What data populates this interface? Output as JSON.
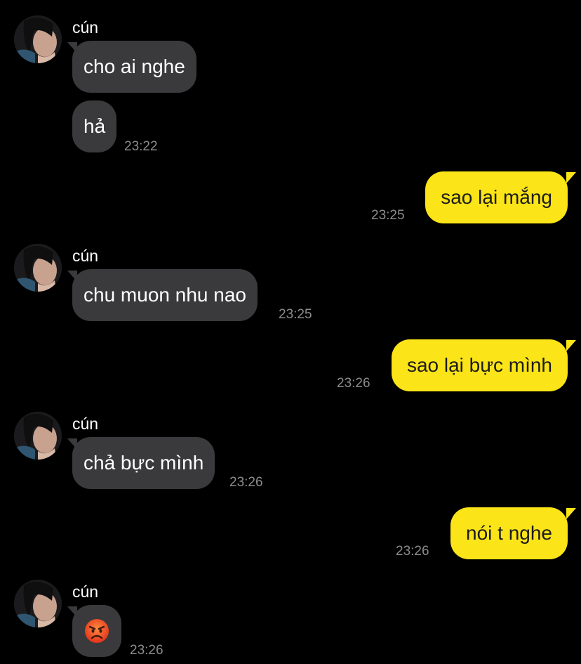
{
  "messages": [
    {
      "side": "in",
      "sender": "cún",
      "text": "cho ai nghe"
    },
    {
      "side": "in",
      "text": "hả",
      "time": "23:22"
    },
    {
      "side": "out",
      "text": "sao lại mắng",
      "time": "23:25"
    },
    {
      "side": "in",
      "sender": "cún",
      "text": "chu muon nhu nao",
      "time": "23:25"
    },
    {
      "side": "out",
      "text": "sao lại bực mình",
      "time": "23:26"
    },
    {
      "side": "in",
      "sender": "cún",
      "text": "chả bực mình",
      "time": "23:26"
    },
    {
      "side": "out",
      "text": "nói t nghe",
      "time": "23:26"
    },
    {
      "side": "in",
      "sender": "cún",
      "emoji": "angry-face-emoji",
      "time": "23:26"
    }
  ],
  "colors": {
    "background": "#000000",
    "incoming_bubble": "#3a3a3c",
    "outgoing_bubble": "#fbe417",
    "timestamp": "#8c8c8c"
  }
}
